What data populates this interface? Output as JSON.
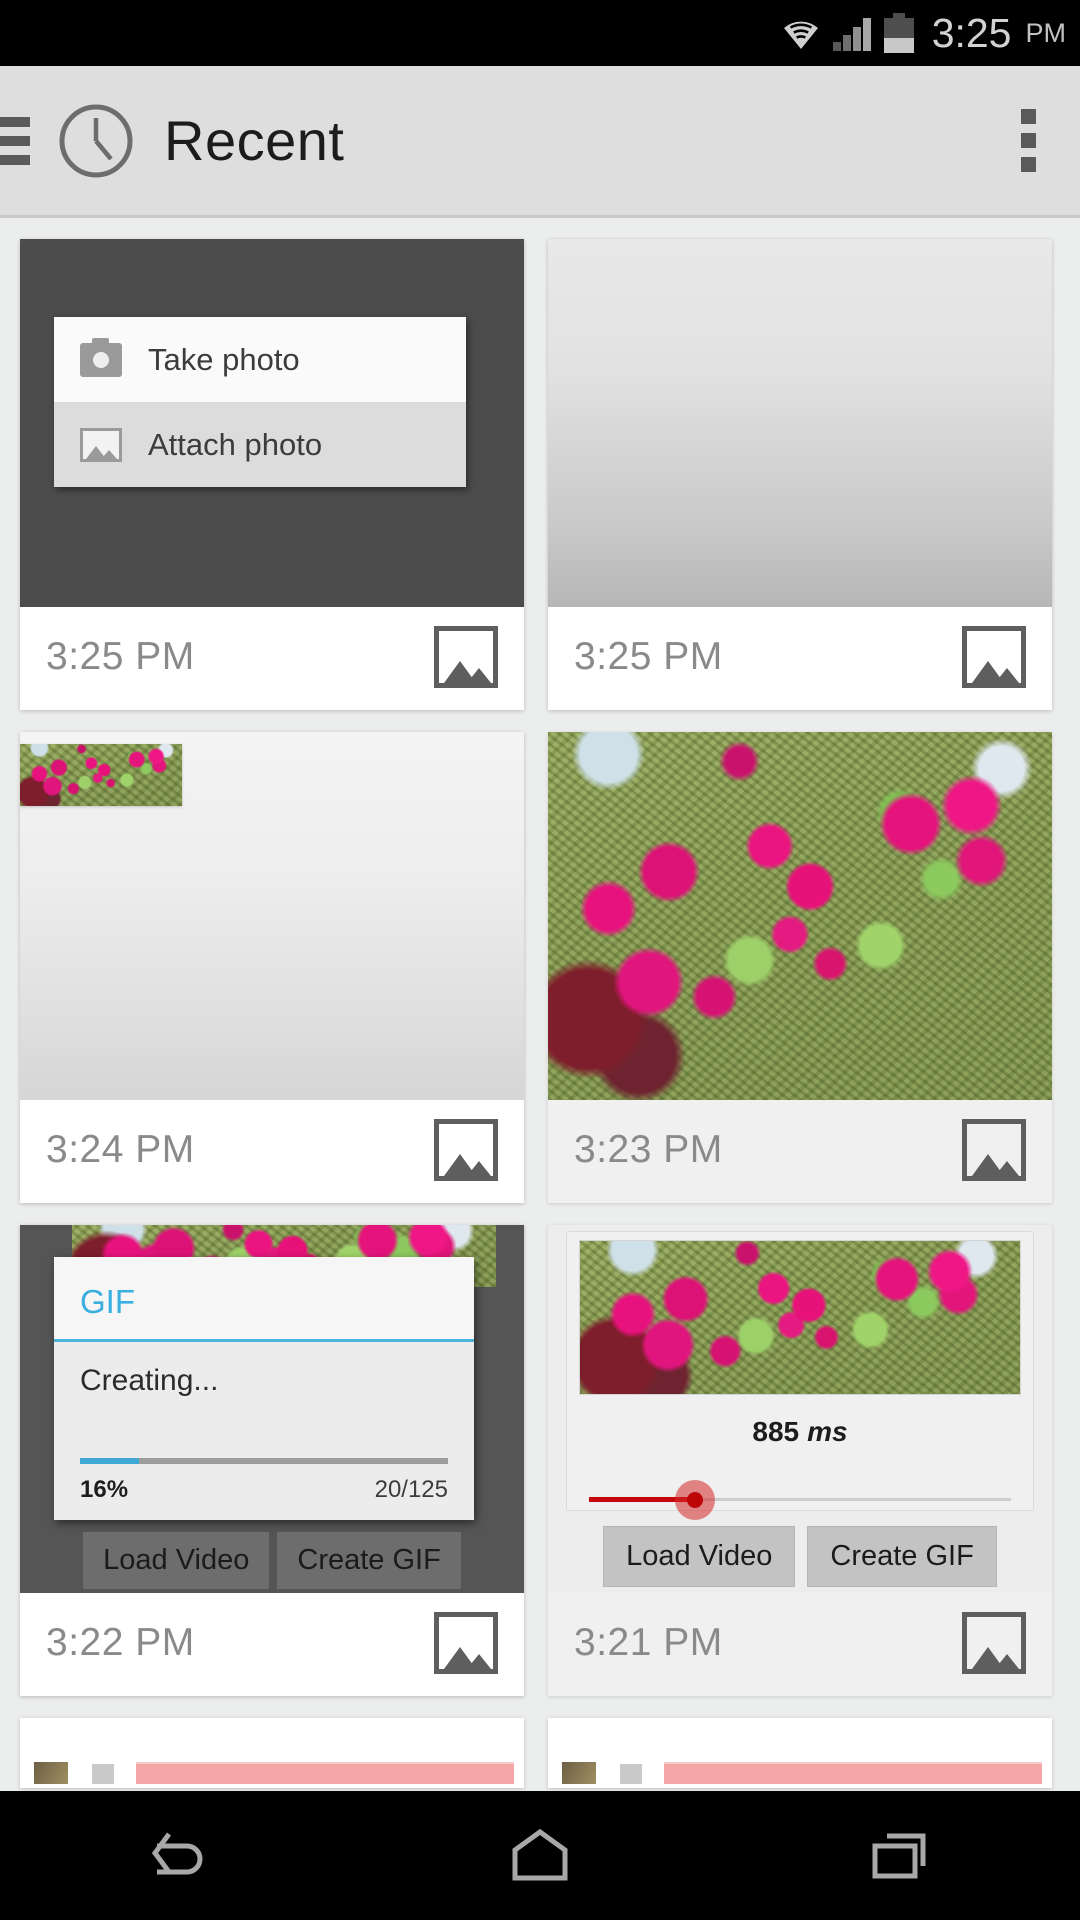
{
  "status_bar": {
    "wifi_icon": "wifi-icon",
    "signal_icon": "cell-signal-icon",
    "battery_icon": "battery-icon",
    "time": "3:25",
    "ampm": "PM"
  },
  "action_bar": {
    "menu_icon": "hamburger-menu-icon",
    "app_icon": "clock-icon",
    "title": "Recent",
    "overflow_icon": "overflow-menu-icon"
  },
  "popup_menu": {
    "items": [
      {
        "label": "Take photo",
        "icon": "camera-icon"
      },
      {
        "label": "Attach photo",
        "icon": "picture-icon"
      }
    ]
  },
  "gif_dialog": {
    "title": "GIF",
    "status": "Creating...",
    "percent_label": "16%",
    "count_label": "20/125",
    "progress_value": 16,
    "progress_max": 100,
    "accent_color": "#3aaede",
    "buttons": [
      "Load Video",
      "Create GIF"
    ]
  },
  "gif_editor": {
    "duration_value": "885",
    "duration_unit": "ms",
    "slider_percent": 25,
    "slider_color": "#c40707",
    "buttons": [
      "Load Video",
      "Create GIF"
    ]
  },
  "cards": [
    {
      "time": "3:25 PM",
      "icon": "image-icon",
      "kind": "popup-menu-screenshot"
    },
    {
      "time": "3:25 PM",
      "icon": "image-icon",
      "kind": "blank-gradient-screenshot"
    },
    {
      "time": "3:24 PM",
      "icon": "image-icon",
      "kind": "mini-photo-screenshot"
    },
    {
      "time": "3:23 PM",
      "icon": "image-icon",
      "kind": "flower-photo-screenshot"
    },
    {
      "time": "3:22 PM",
      "icon": "image-icon",
      "kind": "gif-progress-screenshot"
    },
    {
      "time": "3:21 PM",
      "icon": "image-icon",
      "kind": "gif-editor-screenshot"
    }
  ],
  "nav_bar": {
    "back_icon": "back-arrow-icon",
    "home_icon": "home-icon",
    "recents_icon": "recent-apps-icon"
  }
}
